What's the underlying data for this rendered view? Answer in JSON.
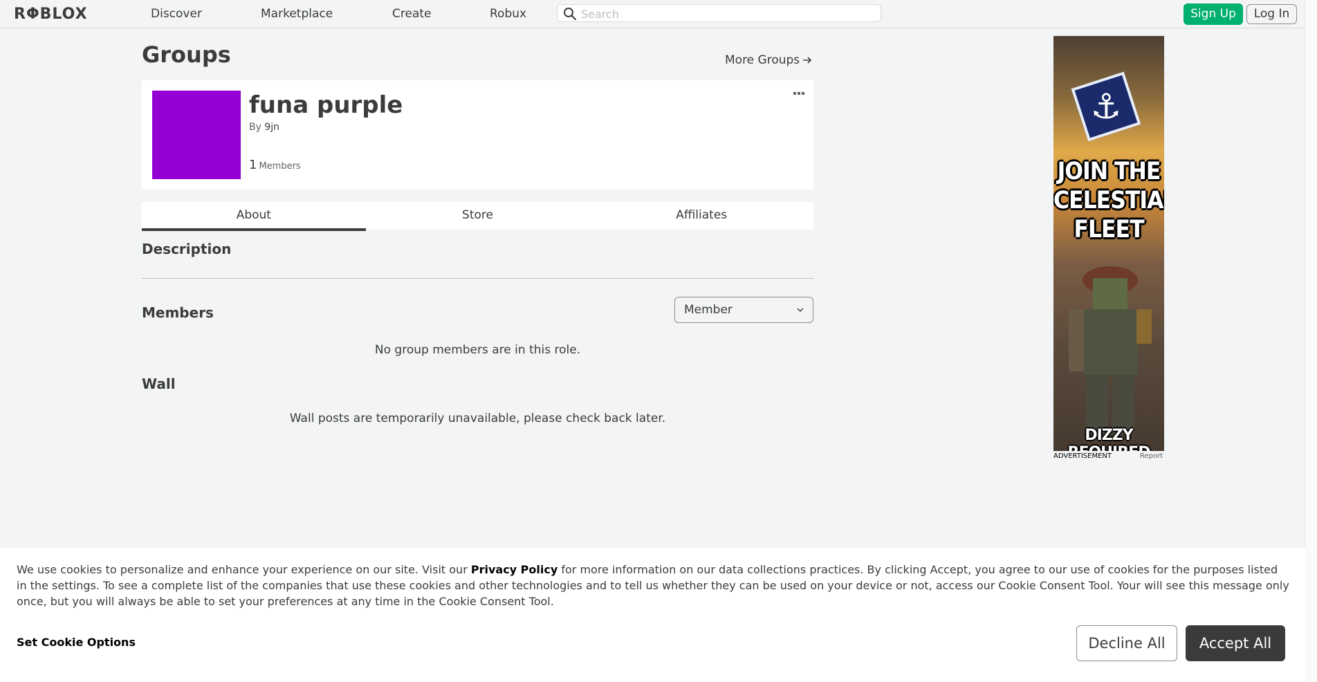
{
  "header": {
    "logo": "RΦBLOX",
    "nav": [
      "Discover",
      "Marketplace",
      "Create",
      "Robux"
    ],
    "search_placeholder": "Search",
    "signup_label": "Sign Up",
    "login_label": "Log In"
  },
  "page": {
    "title": "Groups",
    "more_groups": "More Groups"
  },
  "group": {
    "name": "funa purple",
    "owner_prefix": "By",
    "owner": "9jn",
    "member_count": "1",
    "members_label": "Members",
    "emblem_color": "#9400d3"
  },
  "tabs": [
    "About",
    "Store",
    "Affiliates"
  ],
  "about": {
    "description_title": "Description",
    "members_title": "Members",
    "role_selected": "Member",
    "members_empty": "No group members are in this role.",
    "wall_title": "Wall",
    "wall_empty": "Wall posts are temporarily unavailable, please check back later."
  },
  "ad": {
    "headline": "JOIN THE CELESTIAL FLEET",
    "footer": "DIZZY REQUIRED",
    "label": "ADVERTISEMENT",
    "report": "Report"
  },
  "cookie_banner": {
    "text_before": "We use cookies to personalize and enhance your experience on our site. Visit our ",
    "privacy_link": "Privacy Policy",
    "text_after": " for more information on our data collections practices. By clicking Accept, you agree to our use of cookies for the purposes listed in the settings. To see a complete list of the companies that use these cookies and other technologies and to tell us whether they can be used on your device or not, access our Cookie Consent Tool. Your will see this message only once, but you will always be able to set your preferences at any time in the Cookie Consent Tool.",
    "set_options": "Set Cookie Options",
    "decline": "Decline All",
    "accept": "Accept All"
  },
  "colors": {
    "accent_green": "#00b06f",
    "page_bg": "#f2f4f5",
    "text": "#393b3d"
  }
}
